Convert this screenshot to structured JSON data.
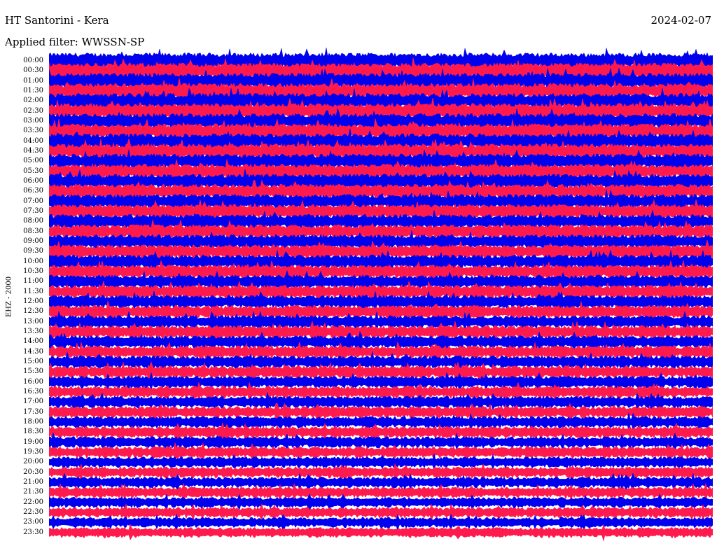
{
  "header": {
    "station": "HT Santorini - Kera",
    "date": "2024-02-07",
    "filter": "Applied filter: WWSSN-SP"
  },
  "channel_label": "EHZ - 2000",
  "time_labels": [
    "00:00",
    "00:30",
    "01:00",
    "01:30",
    "02:00",
    "02:30",
    "03:00",
    "03:30",
    "04:00",
    "04:30",
    "05:00",
    "05:30",
    "06:00",
    "06:30",
    "07:00",
    "07:30",
    "08:00",
    "08:30",
    "09:00",
    "09:30",
    "10:00",
    "10:30",
    "11:00",
    "11:30",
    "12:00",
    "12:30",
    "13:00",
    "13:30",
    "14:00",
    "14:30",
    "15:00",
    "15:30",
    "16:00",
    "16:30",
    "17:00",
    "17:30",
    "18:00",
    "18:30",
    "19:00",
    "19:30",
    "20:00",
    "20:30",
    "21:00",
    "21:30",
    "22:00",
    "22:30",
    "23:00",
    "23:30"
  ],
  "colors": {
    "trace_a": "#0000ee",
    "trace_b": "#ff1a4d",
    "background": "#ffffff",
    "text": "#000000"
  }
}
